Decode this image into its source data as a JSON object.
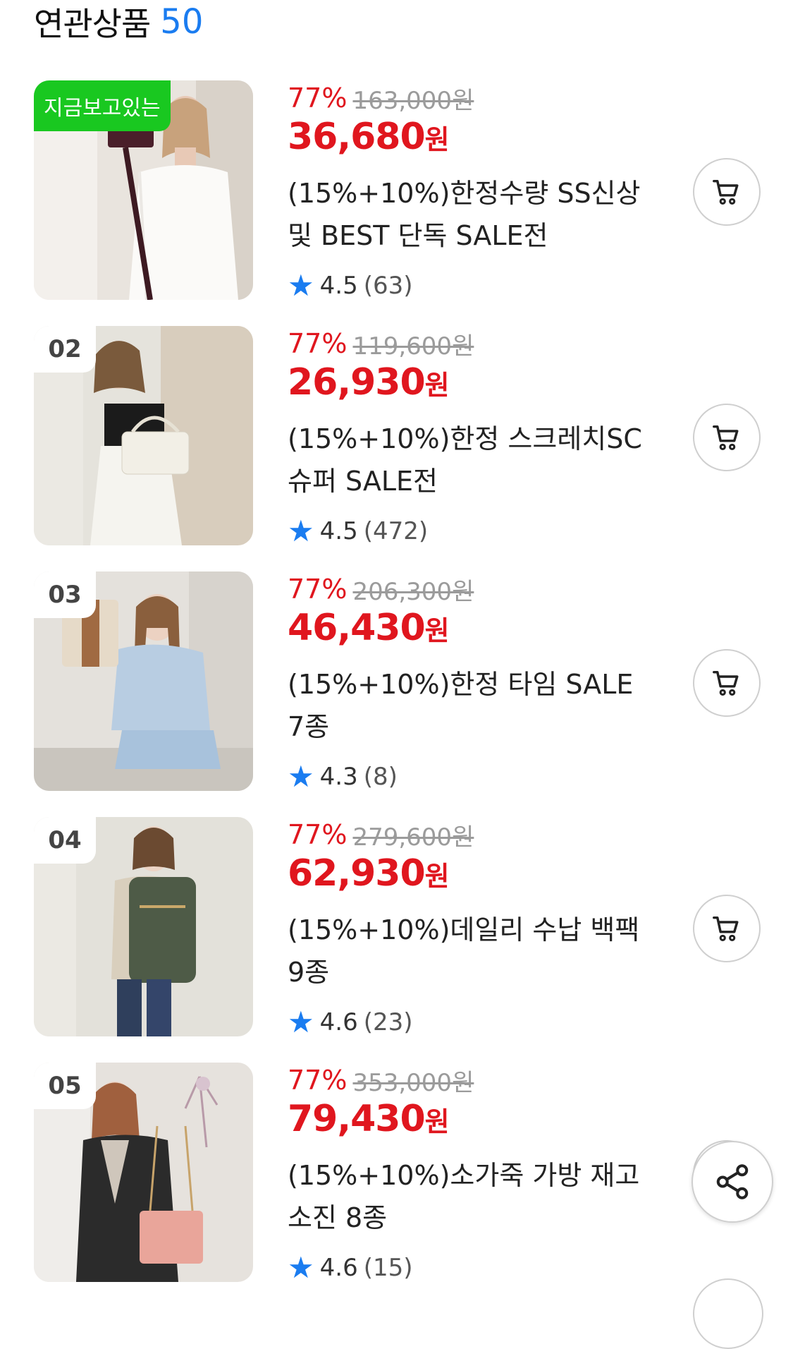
{
  "header": {
    "title": "연관상품",
    "count": "50"
  },
  "items": [
    {
      "rank": "",
      "badge": "지금보고있는",
      "discount": "77%",
      "original_price": "163,000원",
      "price": "36,680",
      "currency": "원",
      "name": "(15%+10%)한정수량 SS신상 및 BEST 단독 SALE전",
      "rating": "4.5",
      "reviews": "(63)"
    },
    {
      "rank": "02",
      "badge": "",
      "discount": "77%",
      "original_price": "119,600원",
      "price": "26,930",
      "currency": "원",
      "name": "(15%+10%)한정 스크레치SC 슈퍼 SALE전",
      "rating": "4.5",
      "reviews": "(472)"
    },
    {
      "rank": "03",
      "badge": "",
      "discount": "77%",
      "original_price": "206,300원",
      "price": "46,430",
      "currency": "원",
      "name": "(15%+10%)한정 타임 SALE 7종",
      "rating": "4.3",
      "reviews": "(8)"
    },
    {
      "rank": "04",
      "badge": "",
      "discount": "77%",
      "original_price": "279,600원",
      "price": "62,930",
      "currency": "원",
      "name": "(15%+10%)데일리 수납 백팩 9종",
      "rating": "4.6",
      "reviews": "(23)"
    },
    {
      "rank": "05",
      "badge": "",
      "discount": "77%",
      "original_price": "353,000원",
      "price": "79,430",
      "currency": "원",
      "name": "(15%+10%)소가죽 가방 재고소진 8종",
      "rating": "4.6",
      "reviews": "(15)"
    }
  ],
  "icons": {
    "cart": "cart-icon",
    "star": "star-icon",
    "share": "share-icon"
  },
  "colors": {
    "accent_red": "#e0161e",
    "accent_blue": "#1a7cf0",
    "badge_green": "#19c820"
  }
}
